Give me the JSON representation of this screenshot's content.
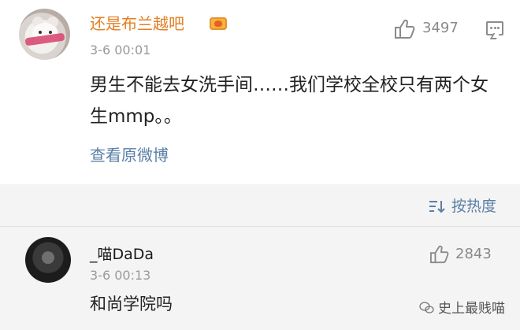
{
  "post": {
    "username": "还是布兰越吧",
    "time": "3-6 00:01",
    "like_count": "3497",
    "content": "男生不能去女洗手间……我们学校全校只有两个女生mmp。。",
    "view_original": "查看原微博"
  },
  "sort": {
    "label": "按热度"
  },
  "comment": {
    "username": "_喵DaDa",
    "time": "3-6 00:13",
    "like_count": "2843",
    "content": "和尚学院吗"
  },
  "watermark": {
    "text": "史上最贱喵"
  },
  "icons": {
    "like": "thumbs-up-icon",
    "comment": "comment-icon",
    "sort": "sort-icon",
    "badge": "crown-badge-icon",
    "watermark": "wechat-logo-icon"
  },
  "colors": {
    "vip_name": "#e67e22",
    "link": "#5a7fa6",
    "lower_bg": "#f4f4f4"
  }
}
